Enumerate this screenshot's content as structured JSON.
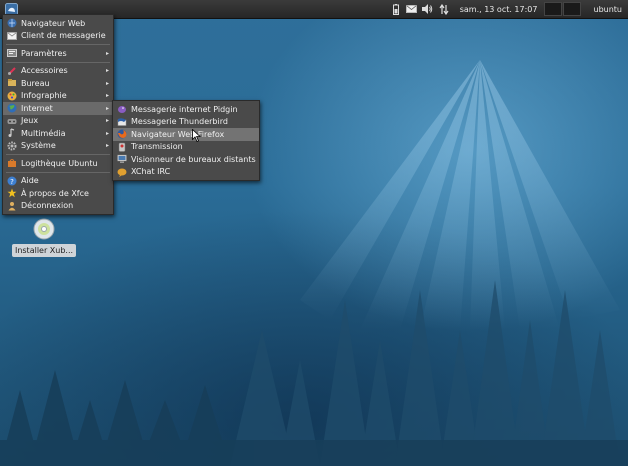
{
  "panel": {
    "clock": "sam., 13 oct.   17:07",
    "user": "ubuntu"
  },
  "main_menu": {
    "items": [
      {
        "label": "Navigateur Web",
        "icon": "web-browser-icon"
      },
      {
        "label": "Client de messagerie",
        "icon": "mail-client-icon"
      },
      {
        "label": "Paramètres",
        "icon": "settings-icon",
        "submenu": true
      },
      {
        "label": "Accessoires",
        "icon": "accessories-icon",
        "submenu": true
      },
      {
        "label": "Bureau",
        "icon": "office-icon",
        "submenu": true
      },
      {
        "label": "Infographie",
        "icon": "graphics-icon",
        "submenu": true
      },
      {
        "label": "Internet",
        "icon": "internet-icon",
        "submenu": true
      },
      {
        "label": "Jeux",
        "icon": "games-icon",
        "submenu": true
      },
      {
        "label": "Multimédia",
        "icon": "multimedia-icon",
        "submenu": true
      },
      {
        "label": "Système",
        "icon": "system-icon",
        "submenu": true
      },
      {
        "label": "Logithèque Ubuntu",
        "icon": "software-center-icon"
      },
      {
        "label": "Aide",
        "icon": "help-icon"
      },
      {
        "label": "À propos de Xfce",
        "icon": "about-icon"
      },
      {
        "label": "Déconnexion",
        "icon": "logout-icon"
      }
    ]
  },
  "internet_menu": {
    "items": [
      {
        "label": "Messagerie internet Pidgin",
        "icon": "pidgin-icon"
      },
      {
        "label": "Messagerie Thunderbird",
        "icon": "thunderbird-icon"
      },
      {
        "label": "Navigateur Web Firefox",
        "icon": "firefox-icon"
      },
      {
        "label": "Transmission",
        "icon": "transmission-icon"
      },
      {
        "label": "Visionneur de bureaux distants",
        "icon": "remote-desktop-icon"
      },
      {
        "label": "XChat IRC",
        "icon": "xchat-icon"
      }
    ]
  },
  "desktop": {
    "icon_label": "Installer Xub..."
  },
  "colors": {
    "menu_bg": "#4a4a4a",
    "panel_bg": "#2e2e2e",
    "desktop_blue": "#2a6c97"
  }
}
